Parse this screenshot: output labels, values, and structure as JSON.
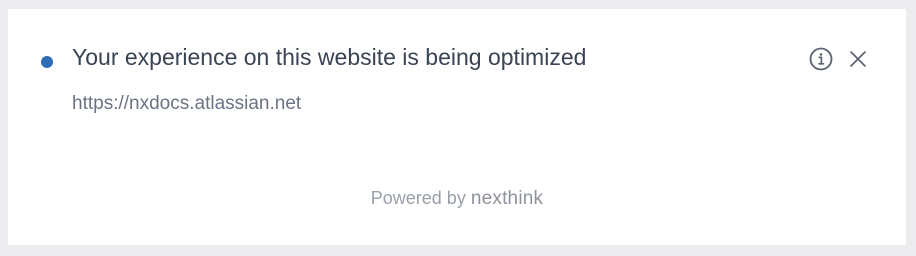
{
  "notification": {
    "title": "Your experience on this website is being optimized",
    "url": "https://nxdocs.atlassian.net",
    "status_color": "#2f6cb8",
    "icons": {
      "info": "info-icon",
      "close": "close-icon"
    }
  },
  "footer": {
    "powered_by": "Powered by",
    "brand": "nexthink"
  }
}
